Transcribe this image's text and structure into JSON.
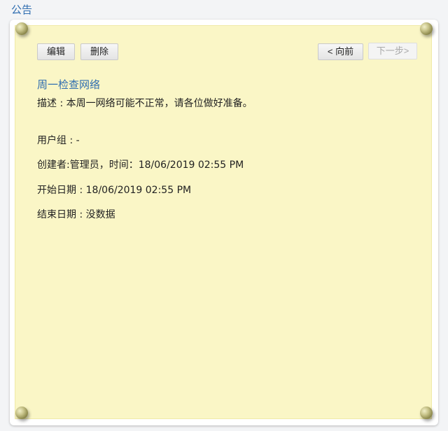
{
  "header": {
    "title": "公告"
  },
  "toolbar": {
    "edit_label": "编辑",
    "delete_label": "删除",
    "prev_label": "< 向前",
    "next_label": "下一步>"
  },
  "notice": {
    "title": "周一检查网络",
    "description_label": "描述 : ",
    "description": "本周一网络可能不正常，请各位做好准备。",
    "user_group_label": "用户组 : ",
    "user_group": "-",
    "creator_label": "创建者:",
    "creator": "管理员",
    "time_label": "，时间：",
    "created_time": "18/06/2019 02:55 PM",
    "start_date_label": "开始日期 : ",
    "start_date": "18/06/2019 02:55 PM",
    "end_date_label": "结束日期 : ",
    "end_date": "没数据"
  }
}
